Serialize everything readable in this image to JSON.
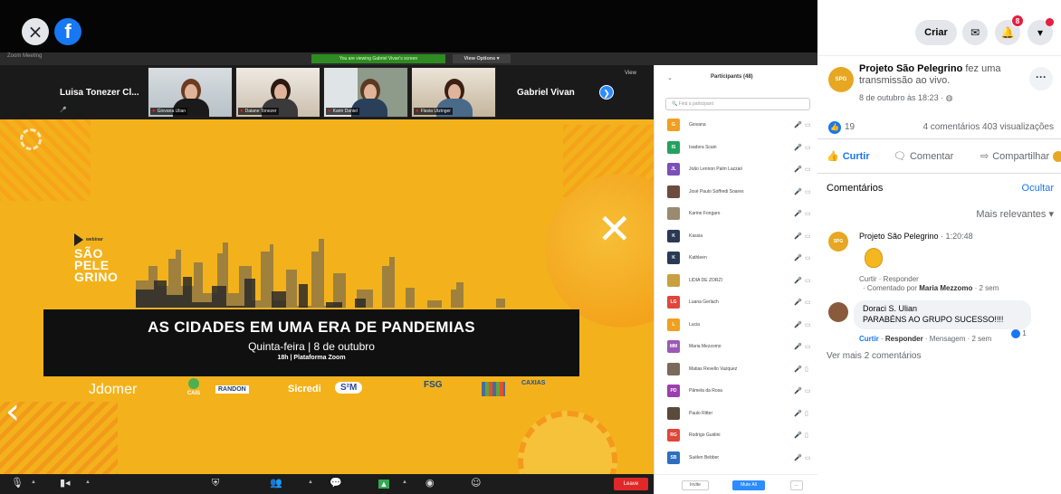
{
  "facebook": {
    "close_icon": "×",
    "logo": "f",
    "header": {
      "create_label": "Criar",
      "notification_count": "8"
    },
    "post": {
      "page_avatar_label": "SPG",
      "page_name": "Projeto São Pelegrino",
      "action_text": "fez uma transmissão ao vivo.",
      "date": "8 de outubro às 18:23 · ",
      "globe_icon": "globe-icon",
      "more_label": "···",
      "like_count": "19",
      "stats": "4 comentários  403 visualizações"
    },
    "actions": {
      "like": "Curtir",
      "comment": "Comentar",
      "share": "Compartilhar"
    },
    "comments": {
      "title": "Comentários",
      "hide": "Ocultar",
      "sort": "Mais relevantes",
      "more": "Ver mais 2 comentários",
      "items": [
        {
          "author": "Projeto São Pelegrino",
          "time": " · 1:20:48",
          "actions": "Curtir · Responder",
          "commented_by_prefix": "· Comentado por ",
          "commented_by": "Maria Mezzomo",
          "commented_by_suffix": " · 2 sem"
        },
        {
          "author": "Doraci S. Ulian",
          "text": "PARABÉNS AO GRUPO SUCESSO!!!!",
          "like": "Curtir",
          "reply": "Responder",
          "rest": " · Mensagem · 2 sem",
          "reaction_count": "1"
        }
      ]
    }
  },
  "zoom": {
    "window_title": "Zoom Meeting",
    "viewing_badge": "You are viewing Gabriel Vivan's screen",
    "view_options": "View Options ▾",
    "gallery_view_label": "View",
    "gallery": {
      "left_name": "Luisa Tonezer Cl...",
      "right_name": "Gabriel Vivan",
      "tiles": [
        "Giovana Ulian",
        "Daiane Tonezer",
        "Karin Daniel",
        "Flavia Utzinger"
      ]
    },
    "participants": {
      "title": "Participants (48)",
      "search_placeholder": "Find a participant",
      "list": [
        {
          "name": "Giovana",
          "initials": "G",
          "color": "#f0a020",
          "cam": "on"
        },
        {
          "name": "Isadora Scain",
          "initials": "IS",
          "color": "#23a25f",
          "cam": "on"
        },
        {
          "name": "João Lennon Palm Lazzari",
          "initials": "JL",
          "color": "#7b4fb5",
          "cam": "on"
        },
        {
          "name": "José Paulo Soffredi Soares",
          "initials": "",
          "color": "#6d4c3d",
          "cam": "on"
        },
        {
          "name": "Karine Fongaro",
          "initials": "",
          "color": "#9a8a70",
          "cam": "on"
        },
        {
          "name": "Kassia",
          "initials": "K",
          "color": "#2a3a55",
          "cam": "on"
        },
        {
          "name": "Kathleen",
          "initials": "K",
          "color": "#2a3a55",
          "cam": "on"
        },
        {
          "name": "LIDIA DE ZORZI",
          "initials": "",
          "color": "#c9a040",
          "cam": "on"
        },
        {
          "name": "Luana Gerlach",
          "initials": "LG",
          "color": "#e0463a",
          "cam": "on"
        },
        {
          "name": "Lucia",
          "initials": "L",
          "color": "#f0a020",
          "cam": "on"
        },
        {
          "name": "Maria Mezzomo",
          "initials": "MM",
          "color": "#9b59b6",
          "cam": "on"
        },
        {
          "name": "Matias Revello Vazquez",
          "initials": "",
          "color": "#7a6a5a",
          "cam": "off"
        },
        {
          "name": "Pâmela da Rosa",
          "initials": "PD",
          "color": "#9b3fb0",
          "cam": "on"
        },
        {
          "name": "Paulo Ritter",
          "initials": "",
          "color": "#5a4a3a",
          "cam": "off"
        },
        {
          "name": "Rodrigo Guidini",
          "initials": "RG",
          "color": "#e0463a",
          "cam": "off"
        },
        {
          "name": "Suélen Bebber",
          "initials": "SB",
          "color": "#2d6fbf",
          "cam": "on"
        }
      ],
      "invite": "Invite",
      "mute_all": "Mute All",
      "more": "..."
    },
    "leave": "Leave",
    "slide": {
      "logo_word": "webinar",
      "logo_lines": [
        "SÃO",
        "PELE",
        "GRINO"
      ],
      "title": "AS CIDADES EM UMA ERA DE PANDEMIAS",
      "date": "Quinta-feira | 8 de outubro",
      "time": "18h | Plataforma Zoom",
      "sponsors": {
        "idomer": "Jdomer",
        "cais": "CAIS",
        "randon": "RANDON",
        "sicredi": "Sicredi",
        "sm": "S²M",
        "fsg": "FSG",
        "gov": "CAXIAS"
      }
    }
  }
}
